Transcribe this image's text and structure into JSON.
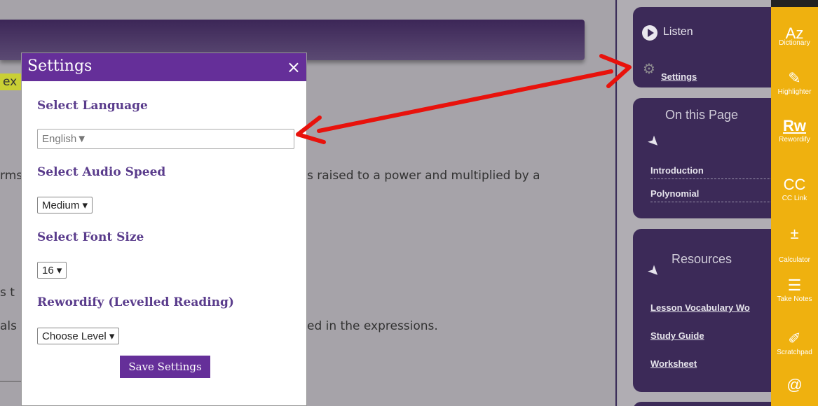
{
  "page": {
    "fragment_hl": "ex",
    "fragment_1": "rms",
    "text_1": "s raised to a power and multiplied by a",
    "fragment_2": "s t",
    "fragment_3": "als",
    "text_2": "ed in the expressions."
  },
  "sidebar": {
    "listen_label": "Listen",
    "settings_link": "Settings",
    "on_this_page_title": "On this Page",
    "toc": [
      "Introduction",
      "Polynomial"
    ],
    "resources_title": "Resources",
    "resources": [
      "Lesson Vocabulary Wo",
      "Study Guide",
      "Worksheet"
    ]
  },
  "toolbar": [
    {
      "icon": "Az",
      "label": "Dictionary"
    },
    {
      "icon": "✎",
      "label": "Highlighter"
    },
    {
      "icon": "Rw",
      "label": "Rewordify"
    },
    {
      "icon": "CC",
      "label": "CC Link"
    },
    {
      "icon": "±",
      "label": "Calculator"
    },
    {
      "icon": "☰",
      "label": "Take Notes"
    },
    {
      "icon": "✐",
      "label": "Scratchpad"
    },
    {
      "icon": "@",
      "label": ""
    }
  ],
  "modal": {
    "title": "Settings",
    "close": "×",
    "language_label": "Select Language",
    "language_value": "English▼",
    "audio_label": "Select Audio Speed",
    "audio_value": "Medium ▾",
    "font_label": "Select Font Size",
    "font_value": "16 ▾",
    "reword_label": "Rewordify (Levelled Reading)",
    "reword_value": "Choose Level ▾",
    "save_button": "Save Settings"
  },
  "colors": {
    "accent": "#652f99",
    "sidebar_box": "#3c2a58",
    "toolbar": "#efb10f",
    "arrow": "#e8120c"
  }
}
